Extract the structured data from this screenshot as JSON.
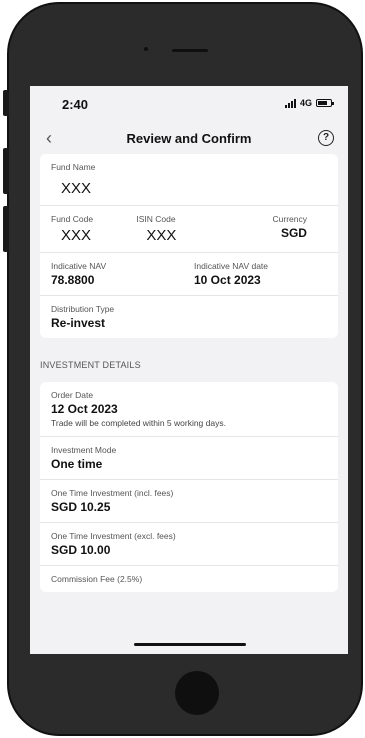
{
  "status": {
    "time": "2:40",
    "network": "4G"
  },
  "nav": {
    "title": "Review and Confirm",
    "help": "?"
  },
  "fund": {
    "name_label": "Fund Name",
    "name_value": "XXX",
    "code_label": "Fund Code",
    "code_value": "XXX",
    "isin_label": "ISIN Code",
    "isin_value": "XXX",
    "currency_label": "Currency",
    "currency_value": "SGD",
    "nav_label": "Indicative NAV",
    "nav_value": "78.8800",
    "nav_date_label": "Indicative NAV date",
    "nav_date_value": "10 Oct 2023",
    "distribution_label": "Distribution Type",
    "distribution_value": "Re-invest"
  },
  "investment": {
    "section_title": "INVESTMENT DETAILS",
    "order_date_label": "Order Date",
    "order_date_value": "12 Oct 2023",
    "order_note": "Trade will be completed within 5 working days.",
    "mode_label": "Investment Mode",
    "mode_value": "One time",
    "incl_label": "One Time Investment (incl. fees)",
    "incl_value": "SGD 10.25",
    "excl_label": "One Time Investment (excl. fees)",
    "excl_value": "SGD 10.00",
    "commission_label": "Commission Fee (2.5%)"
  }
}
